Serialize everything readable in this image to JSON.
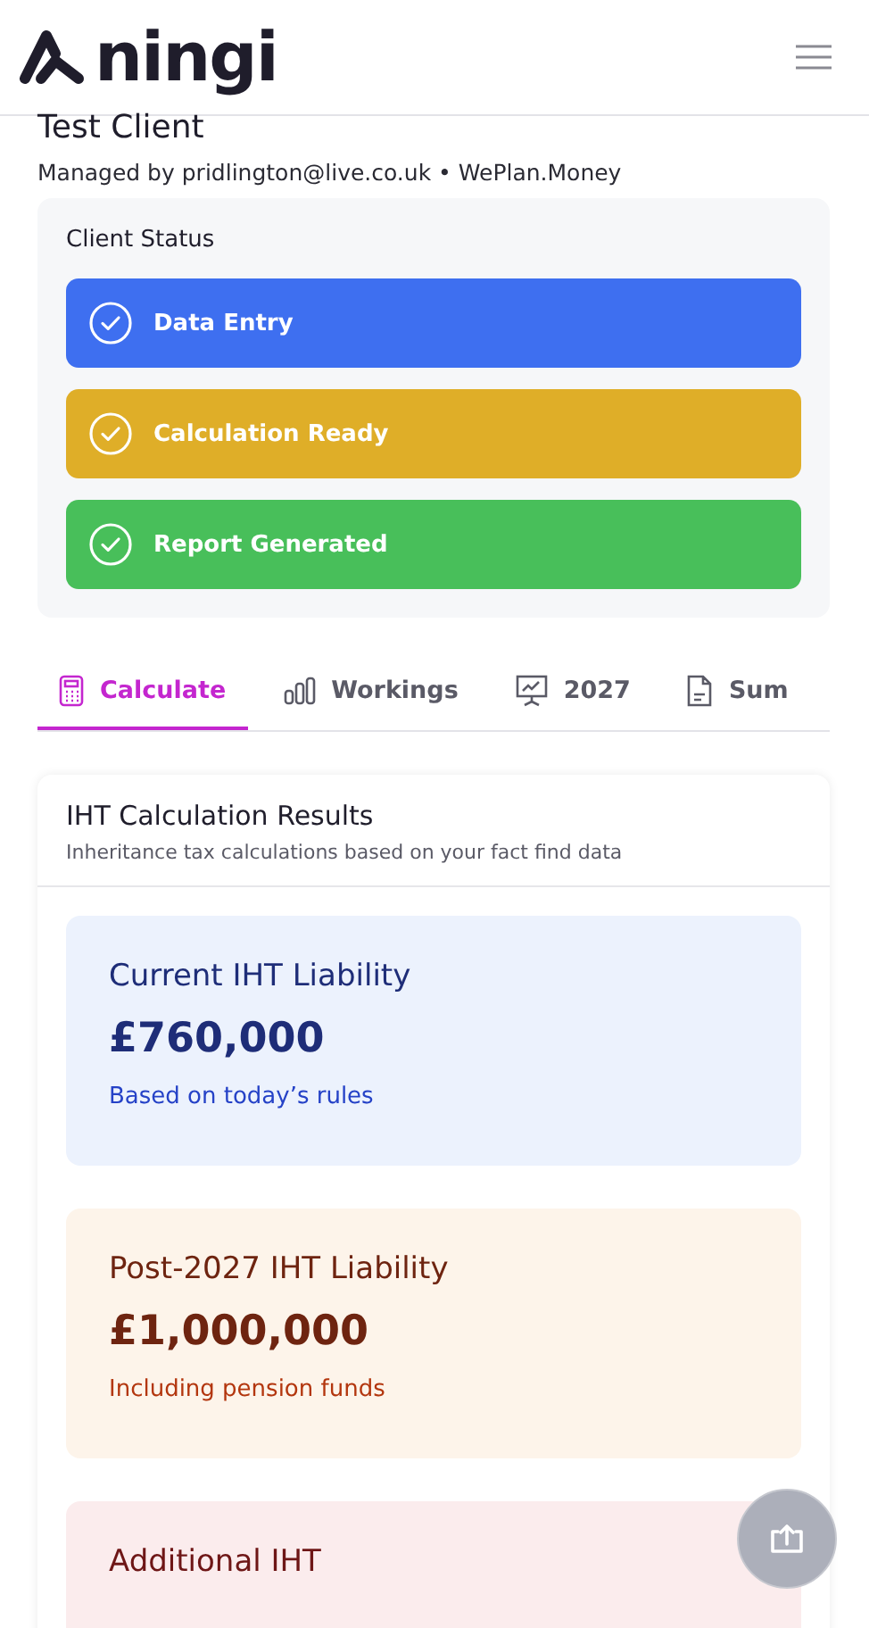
{
  "header": {
    "logo": "ningi"
  },
  "client": {
    "name": "Test Client",
    "managed_by": "Managed by pridlington@live.co.uk • WePlan.Money"
  },
  "status": {
    "title": "Client Status",
    "items": [
      {
        "label": "Data Entry",
        "done": true,
        "color": "#3e6ff0"
      },
      {
        "label": "Calculation Ready",
        "done": true,
        "color": "#dfae28"
      },
      {
        "label": "Report Generated",
        "done": true,
        "color": "#48bf5a"
      }
    ]
  },
  "tabs": [
    {
      "label": "Calculate",
      "kind": "calculator",
      "selected": true
    },
    {
      "label": "Workings",
      "kind": "bars",
      "selected": false
    },
    {
      "label": "2027",
      "kind": "board",
      "selected": false
    },
    {
      "label": "Sum",
      "kind": "document",
      "selected": false
    }
  ],
  "results": {
    "title": "IHT Calculation Results",
    "subtitle": "Inheritance tax calculations based on your fact find data",
    "cards": [
      {
        "kind": "blue",
        "title": "Current IHT Liability",
        "amount": "£760,000",
        "note": "Based on today’s rules"
      },
      {
        "kind": "amber",
        "title": "Post-2027 IHT Liability",
        "amount": "£1,000,000",
        "note": "Including pension funds"
      },
      {
        "kind": "red",
        "title": "Additional IHT"
      }
    ]
  }
}
